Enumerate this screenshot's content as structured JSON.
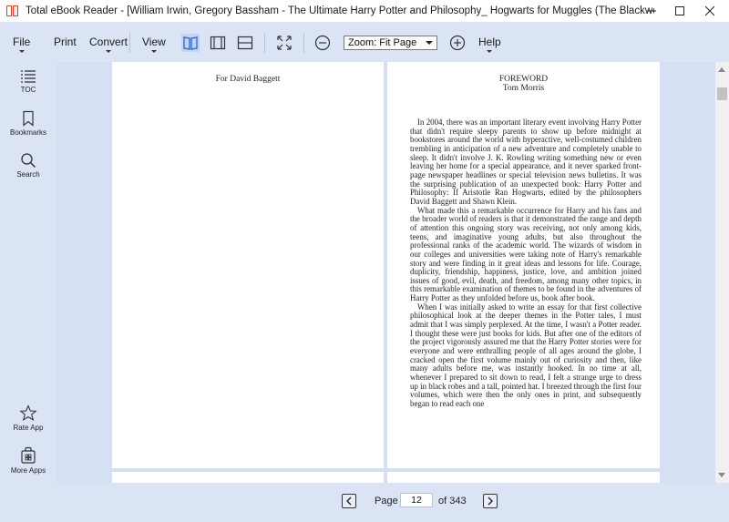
{
  "window": {
    "title": "Total eBook Reader - [William Irwin, Gregory Bassham - The Ultimate Harry Potter and Philosophy_ Hogwarts for Muggles (The Blackwell Philosophy and Pop Culture ..."
  },
  "toolbar": {
    "file": "File",
    "print": "Print",
    "convert": "Convert",
    "view": "View",
    "zoom_value": "Zoom: Fit Page",
    "help": "Help"
  },
  "sidebar": {
    "toc": "TOC",
    "bookmarks": "Bookmarks",
    "search": "Search",
    "rate_app": "Rate App",
    "more_apps": "More Apps"
  },
  "book": {
    "left_page": {
      "dedication": "For David Baggett"
    },
    "right_page": {
      "heading": "FOREWORD",
      "author": "Tom Morris",
      "paragraphs": [
        "In 2004, there was an important literary event involving Harry Potter that didn't require sleepy parents to show up before midnight at bookstores around the world with hyperactive, well-costumed children trembling in anticipation of a new adventure and completely unable to sleep. It didn't involve J. K. Rowling writing something new or even leaving her home for a special appearance, and it never sparked front-page newspaper headlines or special television news bulletins. It was the surprising publication of an unexpected book: Harry Potter and Philosophy: If Aristotle Ran Hogwarts, edited by the philosophers David Baggett and Shawn Klein.",
        "What made this a remarkable occurrence for Harry and his fans and the broader world of readers is that it demonstrated the range and depth of attention this ongoing story was receiving, not only among kids, teens, and imaginative young adults, but also throughout the professional ranks of the academic world. The wizards of wisdom in our colleges and universities were taking note of Harry's remarkable story and were finding in it great ideas and lessons for life. Courage, duplicity, friendship, happiness, justice, love, and ambition joined issues of good, evil, death, and freedom, among many other topics, in this remarkable examination of themes to be found in the adventures of Harry Potter as they unfolded before us, book after book.",
        "When I was initially asked to write an essay for that first collective philosophical look at the deeper themes in the Potter tales, I must admit that I was simply perplexed. At the time, I wasn't a Potter reader. I thought these were just books for kids. But after one of the editors of the project vigorously assured me that the Harry Potter stories were for everyone and were enthralling people of all ages around the globe, I cracked open the first volume mainly out of curiosity and then, like many adults before me, was instantly hooked. In no time at all, whenever I prepared to sit down to read, I felt a strange urge to dress up in black robes and a tall, pointed hat. I breezed through the first four volumes, which were then the only ones in print, and subsequently began to read each one"
      ]
    }
  },
  "pagination": {
    "page_label": "Page",
    "current_page": "12",
    "total_label": "of 343"
  },
  "colors": {
    "chrome_bg": "#dbe4f5",
    "doc_bg": "#d6e0f4",
    "accent": "#2f6fd6",
    "app_icon": "#d83b2a"
  }
}
